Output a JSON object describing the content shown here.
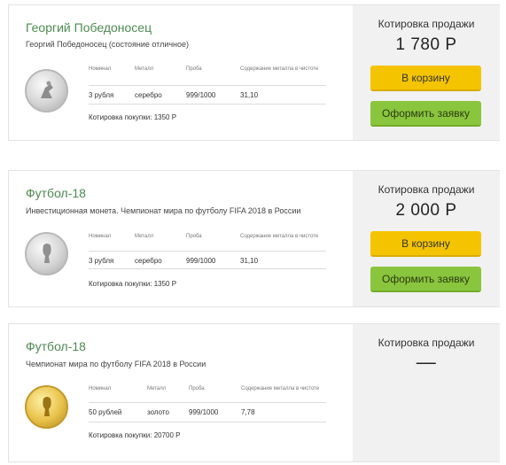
{
  "colors": {
    "title_green": "#4e8a50",
    "cart_yellow": "#f5c400",
    "order_green": "#8ac53e",
    "panel_gray": "#f1f1f1"
  },
  "columns": {
    "nominal": "Номинал",
    "metal": "Металл",
    "proba": "Проба",
    "content": "Содержание металла в чистоте"
  },
  "cards": [
    {
      "title": "Георгий Победоносец",
      "subtitle": "Георгий Победоносец (состояние отличное)",
      "coin_icon": "silver-coin-icon",
      "nominal": "3 рубля",
      "metal": "серебро",
      "proba": "999/1000",
      "content": "31,10",
      "buy_quote_label": "Котировка покупки:",
      "buy_quote_value": "1350 Р",
      "sell_label": "Котировка продажи",
      "sell_price": "1 780 Р",
      "cart_label": "В корзину",
      "order_label": "Оформить заявку"
    },
    {
      "title": "Футбол-18",
      "subtitle": "Инвестиционная монета. Чемпионат мира по футболу FIFA 2018 в России",
      "coin_icon": "silver-coin-icon",
      "nominal": "3 рубля",
      "metal": "серебро",
      "proba": "999/1000",
      "content": "31,10",
      "buy_quote_label": "Котировка покупки:",
      "buy_quote_value": "1350 Р",
      "sell_label": "Котировка продажи",
      "sell_price": "2 000 Р",
      "cart_label": "В корзину",
      "order_label": "Оформить заявку"
    },
    {
      "title": "Футбол-18",
      "subtitle": "Чемпионат мира по футболу FIFA 2018 в России",
      "coin_icon": "gold-coin-icon",
      "nominal": "50 рублей",
      "metal": "золото",
      "proba": "999/1000",
      "content": "7,78",
      "buy_quote_label": "Котировка покупки:",
      "buy_quote_value": "20700 Р",
      "sell_label": "Котировка продажи",
      "sell_price": "—"
    }
  ]
}
